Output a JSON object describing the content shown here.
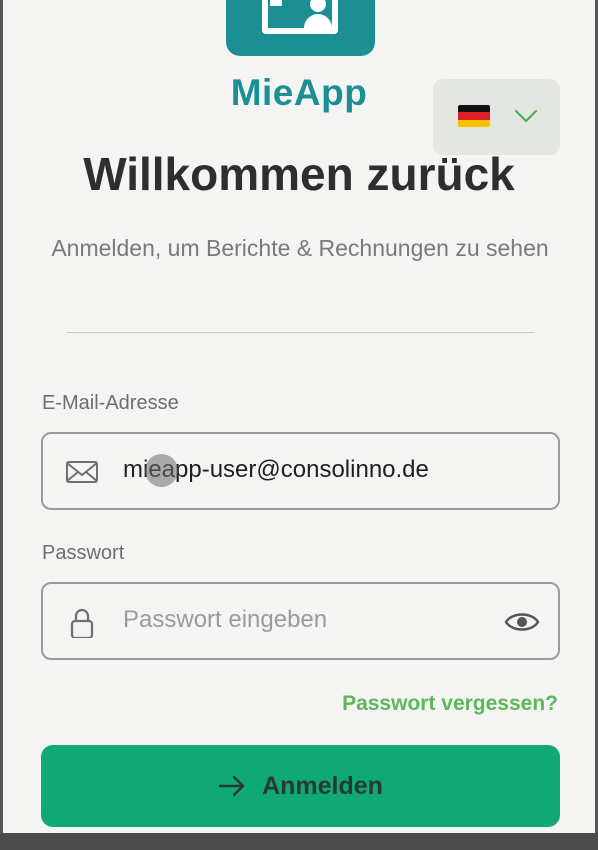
{
  "app": {
    "name": "MieApp"
  },
  "language": {
    "selected": "Deutsch"
  },
  "heading": {
    "title": "Willkommen zurück",
    "subtitle": "Anmelden, um Berichte & Rechnungen zu sehen"
  },
  "form": {
    "email": {
      "label": "E-Mail-Adresse",
      "value": "mieapp-user@consolinno.de",
      "icon": "mail-icon"
    },
    "password": {
      "label": "Passwort",
      "placeholder": "Passwort eingeben",
      "icon": "lock-icon",
      "toggle_icon": "eye-icon"
    },
    "forgot_link": "Passwort vergessen?",
    "submit": {
      "label": "Anmelden",
      "icon": "arrow-right-icon"
    }
  },
  "colors": {
    "brand": "#1b8f94",
    "accent_green": "#10a874",
    "link_green": "#5cb85a",
    "background": "#f4f4f3"
  }
}
